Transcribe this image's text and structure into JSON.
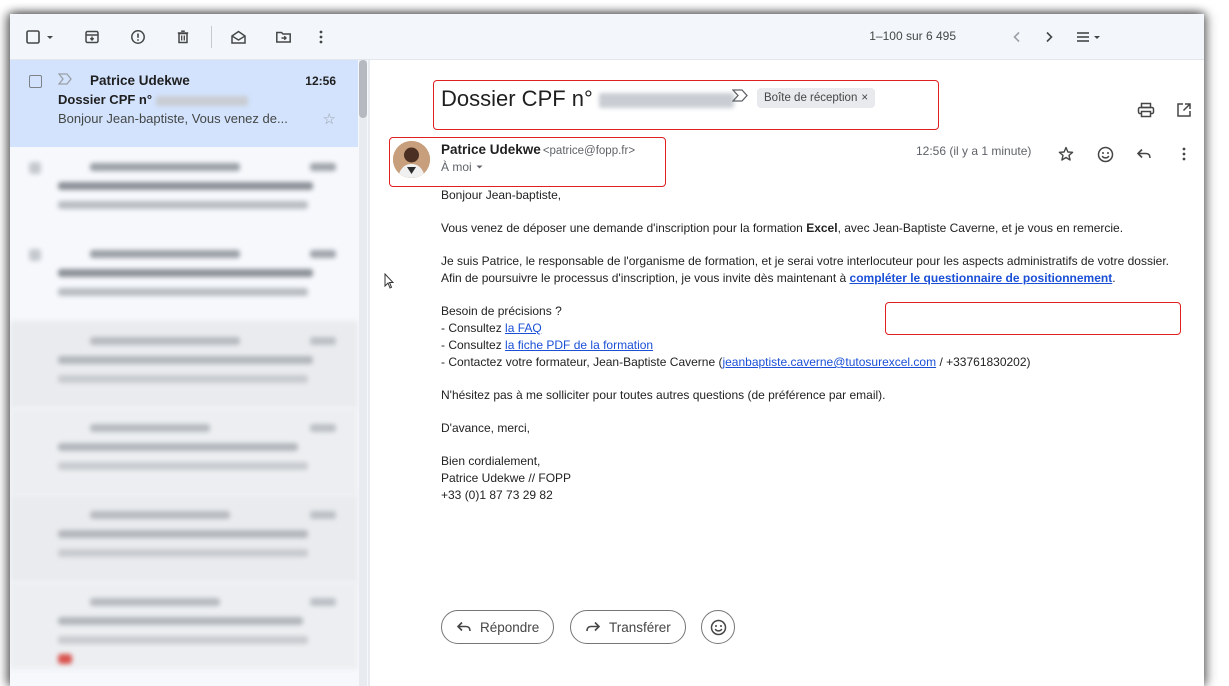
{
  "toolbar": {
    "pager": "1–100 sur 6 495"
  },
  "list": {
    "active_item": {
      "sender": "Patrice Udekwe",
      "time": "12:56",
      "subject": "Dossier CPF n°",
      "snippet": "Bonjour Jean-baptiste, Vous venez de..."
    }
  },
  "message": {
    "subject": "Dossier CPF n°",
    "label": "Boîte de réception",
    "label_remove": "×",
    "from_name": "Patrice Udekwe",
    "from_email": "<patrice@fopp.fr>",
    "to": "À moi",
    "time": "12:56 (il y a 1 minute)",
    "body": {
      "greeting": "Bonjour Jean-baptiste,",
      "p1_a": "Vous venez de déposer une demande d'inscription pour la formation ",
      "p1_b": "Excel",
      "p1_c": ", avec Jean-Baptiste Caverne, et je vous en remercie.",
      "p2_a": "Je suis Patrice, le responsable de l'organisme de formation, et je serai votre interlocuteur pour les aspects administratifs de votre dossier.",
      "p2_b": "Afin de poursuivre le processus d'inscription, je vous invite dès maintenant à ",
      "p2_link": "compléter le questionnaire de positionnement",
      "p2_end": ".",
      "help_title": "Besoin de précisions ?",
      "help1_a": "- Consultez ",
      "help1_link": "la FAQ",
      "help2_a": "- Consultez ",
      "help2_link": "la fiche PDF de la formation",
      "help3_a": "- Contactez votre formateur, Jean-Baptiste Caverne (",
      "help3_link": "jeanbaptiste.caverne@tutosurexcel.com",
      "help3_b": " / +33761830202)",
      "p3": "N'hésitez pas à me solliciter pour toutes autres questions (de préférence par email).",
      "p4": "D'avance, merci,",
      "sig1": "Bien cordialement,",
      "sig2": "Patrice Udekwe // FOPP",
      "sig3": "+33 (0)1 87 73 29 82"
    }
  },
  "actions": {
    "reply": "Répondre",
    "forward": "Transférer"
  },
  "icons": [
    "checkbox-icon",
    "chevron-down-icon",
    "archive-icon",
    "report-spam-icon",
    "delete-icon",
    "mark-unread-icon",
    "move-to-icon",
    "more-vert-icon",
    "chevron-left-icon",
    "chevron-right-icon",
    "density-icon",
    "print-icon",
    "open-new-window-icon",
    "star-icon",
    "emoji-icon",
    "reply-icon",
    "forward-icon",
    "importance-icon",
    "mouse-cursor-icon"
  ],
  "colors": {
    "highlight_box": "#e01f1f",
    "active_row": "#d3e3fd",
    "link": "#1a4fd6",
    "toolbar_bg": "#f3f6fb"
  }
}
